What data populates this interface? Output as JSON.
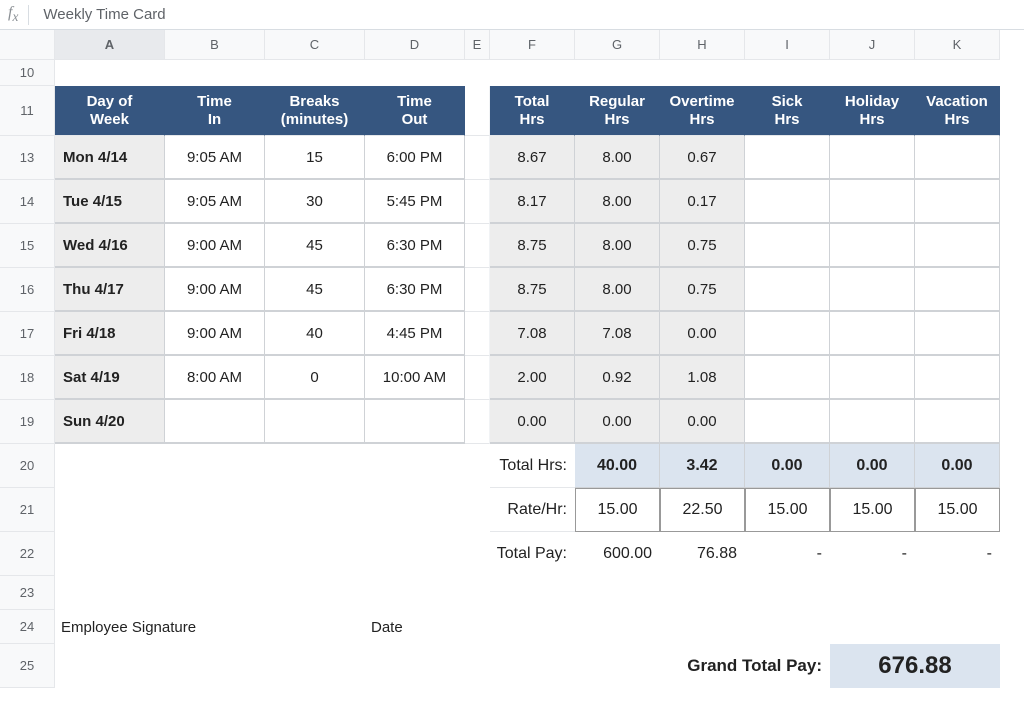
{
  "formula_bar": "Weekly Time Card",
  "columns": [
    "A",
    "B",
    "C",
    "D",
    "E",
    "F",
    "G",
    "H",
    "I",
    "J",
    "K"
  ],
  "active_column": "A",
  "row_numbers": [
    10,
    11,
    13,
    14,
    15,
    16,
    17,
    18,
    19,
    20,
    21,
    22,
    23,
    24,
    25
  ],
  "headers_left": {
    "day": "Day of\nWeek",
    "time_in": "Time\nIn",
    "breaks": "Breaks\n(minutes)",
    "time_out": "Time\nOut"
  },
  "headers_right": {
    "total_hrs": "Total\nHrs",
    "regular": "Regular\nHrs",
    "overtime": "Overtime\nHrs",
    "sick": "Sick\nHrs",
    "holiday": "Holiday\nHrs",
    "vacation": "Vacation\nHrs"
  },
  "rows": [
    {
      "day": "Mon 4/14",
      "in": "9:05 AM",
      "breaks": "15",
      "out": "6:00 PM",
      "total": "8.67",
      "reg": "8.00",
      "ot": "0.67",
      "sick": "",
      "hol": "",
      "vac": ""
    },
    {
      "day": "Tue 4/15",
      "in": "9:05 AM",
      "breaks": "30",
      "out": "5:45 PM",
      "total": "8.17",
      "reg": "8.00",
      "ot": "0.17",
      "sick": "",
      "hol": "",
      "vac": ""
    },
    {
      "day": "Wed 4/16",
      "in": "9:00 AM",
      "breaks": "45",
      "out": "6:30 PM",
      "total": "8.75",
      "reg": "8.00",
      "ot": "0.75",
      "sick": "",
      "hol": "",
      "vac": ""
    },
    {
      "day": "Thu 4/17",
      "in": "9:00 AM",
      "breaks": "45",
      "out": "6:30 PM",
      "total": "8.75",
      "reg": "8.00",
      "ot": "0.75",
      "sick": "",
      "hol": "",
      "vac": ""
    },
    {
      "day": "Fri 4/18",
      "in": "9:00 AM",
      "breaks": "40",
      "out": "4:45 PM",
      "total": "7.08",
      "reg": "7.08",
      "ot": "0.00",
      "sick": "",
      "hol": "",
      "vac": ""
    },
    {
      "day": "Sat 4/19",
      "in": "8:00 AM",
      "breaks": "0",
      "out": "10:00 AM",
      "total": "2.00",
      "reg": "0.92",
      "ot": "1.08",
      "sick": "",
      "hol": "",
      "vac": ""
    },
    {
      "day": "Sun 4/20",
      "in": "",
      "breaks": "",
      "out": "",
      "total": "0.00",
      "reg": "0.00",
      "ot": "0.00",
      "sick": "",
      "hol": "",
      "vac": ""
    }
  ],
  "labels": {
    "total_hrs": "Total Hrs:",
    "rate_hr": "Rate/Hr:",
    "total_pay": "Total Pay:",
    "employee_signature": "Employee Signature",
    "date": "Date",
    "grand_total": "Grand Total Pay:"
  },
  "totals": {
    "hrs": {
      "reg": "40.00",
      "ot": "3.42",
      "sick": "0.00",
      "hol": "0.00",
      "vac": "0.00"
    },
    "rate": {
      "reg": "15.00",
      "ot": "22.50",
      "sick": "15.00",
      "hol": "15.00",
      "vac": "15.00"
    },
    "pay": {
      "reg": "600.00",
      "ot": "76.88",
      "sick": "-",
      "hol": "-",
      "vac": "-"
    }
  },
  "grand_total": "676.88"
}
